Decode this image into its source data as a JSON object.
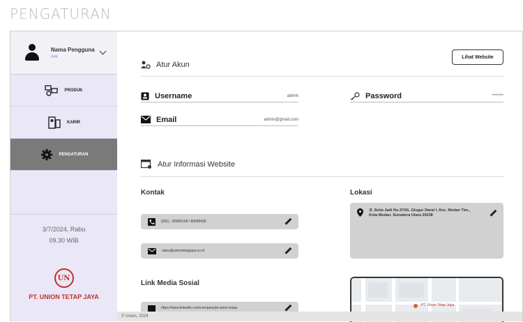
{
  "page": {
    "title": "PENGATURAN"
  },
  "user": {
    "name": "Nama Pengguna",
    "role": "###"
  },
  "sidebar": {
    "items": [
      {
        "label": "PRODUK",
        "icon": "products-icon",
        "active": false
      },
      {
        "label": "KARIR",
        "icon": "career-icon",
        "active": false
      },
      {
        "label": "PENGATURAN",
        "icon": "gear-icon",
        "active": true
      }
    ],
    "date": "3/7/2024, Rabu",
    "time": "09.30 WIB",
    "company": "PT. UNION TETAP JAYA",
    "logo_text": "UN"
  },
  "header": {
    "website_button": "Lihat Website"
  },
  "account": {
    "title": "Atur Akun",
    "username_label": "Username",
    "username_value": "admin",
    "password_label": "Password",
    "password_value": "*******",
    "email_label": "Email",
    "email_value": "admin@gmail.com"
  },
  "website": {
    "title": "Atur Informasi Website",
    "contact_title": "Kontak",
    "phone": "(061) - 80089158 / 80089436",
    "email": "sales@uniontetapjaya.co.id",
    "location_title": "Lokasi",
    "address": "Jl. Setia Jadi No.37/41, Glugur Darat I, Kec. Medan Tim., Kota Medan, Sumatera Utara 20238",
    "social_title": "Link Media Sosial",
    "social_link": "https://www.linkedin.com/company/pt-union-tetap-",
    "map_label": "PT. Union Tetap Jaya"
  },
  "footer": {
    "text": "© Union, 2024"
  },
  "colors": {
    "sidebar_bg": "#eae7f6",
    "active_bg": "#7a7a7a",
    "brand_red": "#c0302a",
    "pill_bg": "#d1d1d1"
  }
}
